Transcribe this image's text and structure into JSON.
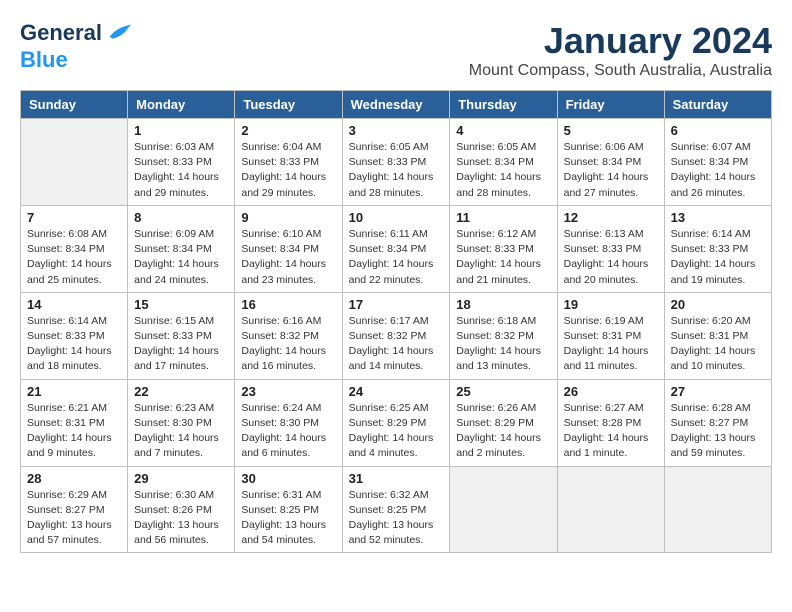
{
  "header": {
    "logo_line1": "General",
    "logo_line2": "Blue",
    "month": "January 2024",
    "location": "Mount Compass, South Australia, Australia"
  },
  "weekdays": [
    "Sunday",
    "Monday",
    "Tuesday",
    "Wednesday",
    "Thursday",
    "Friday",
    "Saturday"
  ],
  "weeks": [
    [
      {
        "day": "",
        "info": ""
      },
      {
        "day": "1",
        "info": "Sunrise: 6:03 AM\nSunset: 8:33 PM\nDaylight: 14 hours\nand 29 minutes."
      },
      {
        "day": "2",
        "info": "Sunrise: 6:04 AM\nSunset: 8:33 PM\nDaylight: 14 hours\nand 29 minutes."
      },
      {
        "day": "3",
        "info": "Sunrise: 6:05 AM\nSunset: 8:33 PM\nDaylight: 14 hours\nand 28 minutes."
      },
      {
        "day": "4",
        "info": "Sunrise: 6:05 AM\nSunset: 8:34 PM\nDaylight: 14 hours\nand 28 minutes."
      },
      {
        "day": "5",
        "info": "Sunrise: 6:06 AM\nSunset: 8:34 PM\nDaylight: 14 hours\nand 27 minutes."
      },
      {
        "day": "6",
        "info": "Sunrise: 6:07 AM\nSunset: 8:34 PM\nDaylight: 14 hours\nand 26 minutes."
      }
    ],
    [
      {
        "day": "7",
        "info": "Sunrise: 6:08 AM\nSunset: 8:34 PM\nDaylight: 14 hours\nand 25 minutes."
      },
      {
        "day": "8",
        "info": "Sunrise: 6:09 AM\nSunset: 8:34 PM\nDaylight: 14 hours\nand 24 minutes."
      },
      {
        "day": "9",
        "info": "Sunrise: 6:10 AM\nSunset: 8:34 PM\nDaylight: 14 hours\nand 23 minutes."
      },
      {
        "day": "10",
        "info": "Sunrise: 6:11 AM\nSunset: 8:34 PM\nDaylight: 14 hours\nand 22 minutes."
      },
      {
        "day": "11",
        "info": "Sunrise: 6:12 AM\nSunset: 8:33 PM\nDaylight: 14 hours\nand 21 minutes."
      },
      {
        "day": "12",
        "info": "Sunrise: 6:13 AM\nSunset: 8:33 PM\nDaylight: 14 hours\nand 20 minutes."
      },
      {
        "day": "13",
        "info": "Sunrise: 6:14 AM\nSunset: 8:33 PM\nDaylight: 14 hours\nand 19 minutes."
      }
    ],
    [
      {
        "day": "14",
        "info": "Sunrise: 6:14 AM\nSunset: 8:33 PM\nDaylight: 14 hours\nand 18 minutes."
      },
      {
        "day": "15",
        "info": "Sunrise: 6:15 AM\nSunset: 8:33 PM\nDaylight: 14 hours\nand 17 minutes."
      },
      {
        "day": "16",
        "info": "Sunrise: 6:16 AM\nSunset: 8:32 PM\nDaylight: 14 hours\nand 16 minutes."
      },
      {
        "day": "17",
        "info": "Sunrise: 6:17 AM\nSunset: 8:32 PM\nDaylight: 14 hours\nand 14 minutes."
      },
      {
        "day": "18",
        "info": "Sunrise: 6:18 AM\nSunset: 8:32 PM\nDaylight: 14 hours\nand 13 minutes."
      },
      {
        "day": "19",
        "info": "Sunrise: 6:19 AM\nSunset: 8:31 PM\nDaylight: 14 hours\nand 11 minutes."
      },
      {
        "day": "20",
        "info": "Sunrise: 6:20 AM\nSunset: 8:31 PM\nDaylight: 14 hours\nand 10 minutes."
      }
    ],
    [
      {
        "day": "21",
        "info": "Sunrise: 6:21 AM\nSunset: 8:31 PM\nDaylight: 14 hours\nand 9 minutes."
      },
      {
        "day": "22",
        "info": "Sunrise: 6:23 AM\nSunset: 8:30 PM\nDaylight: 14 hours\nand 7 minutes."
      },
      {
        "day": "23",
        "info": "Sunrise: 6:24 AM\nSunset: 8:30 PM\nDaylight: 14 hours\nand 6 minutes."
      },
      {
        "day": "24",
        "info": "Sunrise: 6:25 AM\nSunset: 8:29 PM\nDaylight: 14 hours\nand 4 minutes."
      },
      {
        "day": "25",
        "info": "Sunrise: 6:26 AM\nSunset: 8:29 PM\nDaylight: 14 hours\nand 2 minutes."
      },
      {
        "day": "26",
        "info": "Sunrise: 6:27 AM\nSunset: 8:28 PM\nDaylight: 14 hours\nand 1 minute."
      },
      {
        "day": "27",
        "info": "Sunrise: 6:28 AM\nSunset: 8:27 PM\nDaylight: 13 hours\nand 59 minutes."
      }
    ],
    [
      {
        "day": "28",
        "info": "Sunrise: 6:29 AM\nSunset: 8:27 PM\nDaylight: 13 hours\nand 57 minutes."
      },
      {
        "day": "29",
        "info": "Sunrise: 6:30 AM\nSunset: 8:26 PM\nDaylight: 13 hours\nand 56 minutes."
      },
      {
        "day": "30",
        "info": "Sunrise: 6:31 AM\nSunset: 8:25 PM\nDaylight: 13 hours\nand 54 minutes."
      },
      {
        "day": "31",
        "info": "Sunrise: 6:32 AM\nSunset: 8:25 PM\nDaylight: 13 hours\nand 52 minutes."
      },
      {
        "day": "",
        "info": ""
      },
      {
        "day": "",
        "info": ""
      },
      {
        "day": "",
        "info": ""
      }
    ]
  ]
}
